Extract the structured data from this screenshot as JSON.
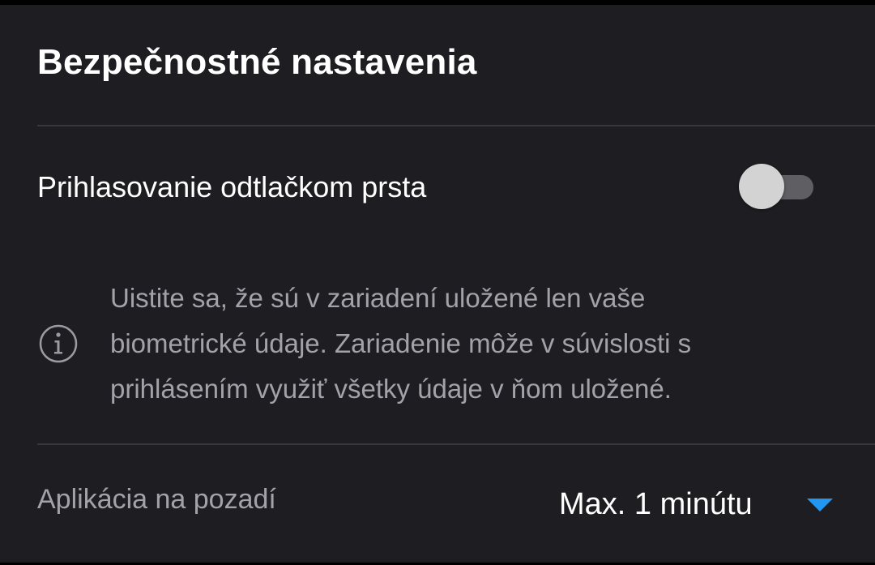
{
  "settings": {
    "title": "Bezpečnostné nastavenia",
    "fingerprint": {
      "label": "Prihlasovanie odtlačkom prsta",
      "enabled": false
    },
    "info": {
      "icon": "info-circle-icon",
      "line1": "Uistite sa, že sú v zariadení uložené len vaše",
      "line2": "biometrické údaje. Zariadenie môže v súvislosti s",
      "line3": "prihlásením využiť všetky údaje v ňom uložené."
    },
    "background_app": {
      "label": "Aplikácia na pozadí",
      "selected": "Max. 1 minútu"
    }
  },
  "colors": {
    "background": "#1e1e22",
    "accent": "#2196f3",
    "primary_text": "#ffffff",
    "secondary_text": "#a2a2a8"
  }
}
